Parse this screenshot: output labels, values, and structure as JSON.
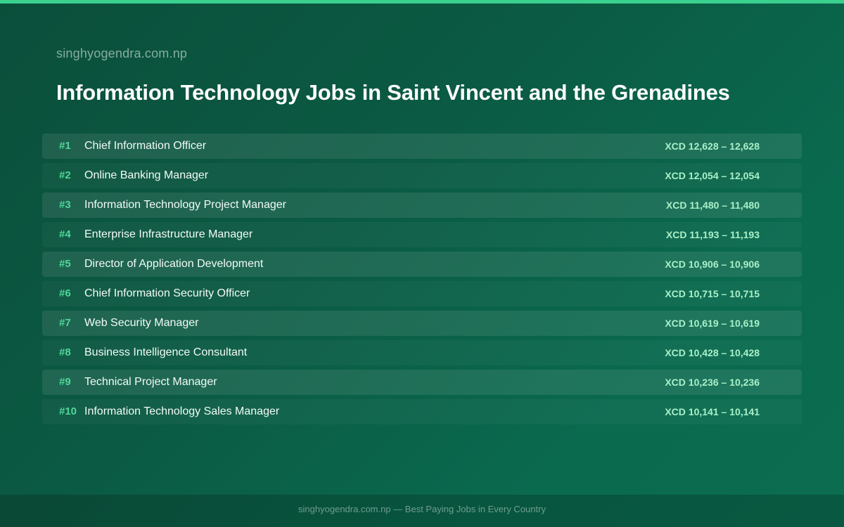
{
  "site_name": "singhyogendra.com.np",
  "title": "Information Technology Jobs in Saint Vincent and the Grenadines",
  "colors": {
    "accent": "#3ad08d",
    "rank": "#4fd79a",
    "salary": "#a9f0c9"
  },
  "jobs": [
    {
      "rank": "#1",
      "title": "Chief Information Officer",
      "salary": "XCD 12,628 – 12,628"
    },
    {
      "rank": "#2",
      "title": "Online Banking Manager",
      "salary": "XCD 12,054 – 12,054"
    },
    {
      "rank": "#3",
      "title": "Information Technology Project Manager",
      "salary": "XCD 11,480 – 11,480"
    },
    {
      "rank": "#4",
      "title": "Enterprise Infrastructure Manager",
      "salary": "XCD 11,193 – 11,193"
    },
    {
      "rank": "#5",
      "title": "Director of Application Development",
      "salary": "XCD 10,906 – 10,906"
    },
    {
      "rank": "#6",
      "title": "Chief Information Security Officer",
      "salary": "XCD 10,715 – 10,715"
    },
    {
      "rank": "#7",
      "title": "Web Security Manager",
      "salary": "XCD 10,619 – 10,619"
    },
    {
      "rank": "#8",
      "title": "Business Intelligence Consultant",
      "salary": "XCD 10,428 – 10,428"
    },
    {
      "rank": "#9",
      "title": "Technical Project Manager",
      "salary": "XCD 10,236 – 10,236"
    },
    {
      "rank": "#10",
      "title": "Information Technology Sales Manager",
      "salary": "XCD 10,141 – 10,141"
    }
  ],
  "footer": "singhyogendra.com.np — Best Paying Jobs in Every Country"
}
